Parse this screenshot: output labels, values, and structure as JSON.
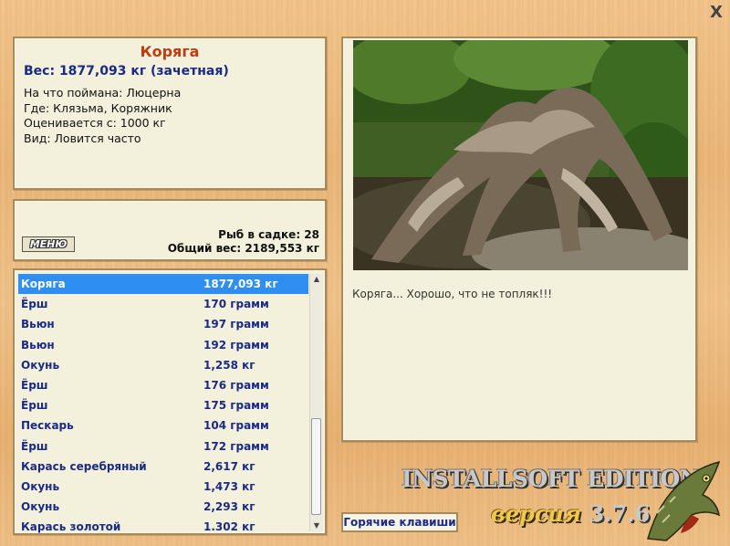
{
  "fish": {
    "name": "Коряга",
    "weight_line": "Вес: 1877,093 кг (зачетная)",
    "caught_on": "На что поймана: Люцерна",
    "where": "Где: Клязьма, Коряжник",
    "valued_from": "Оценивается с: 1000 кг",
    "kind": "Вид: Ловится часто"
  },
  "stats": {
    "menu_label": "МЕНЮ",
    "fish_in_net": "Рыб в садке: 28",
    "total_weight": "Общий вес: 2189,553 кг"
  },
  "catch_list": [
    {
      "name": "Коряга",
      "weight": "1877,093 кг",
      "selected": true
    },
    {
      "name": "Ёрш",
      "weight": "170 грамм"
    },
    {
      "name": "Вьюн",
      "weight": "197 грамм"
    },
    {
      "name": "Вьюн",
      "weight": "192 грамм"
    },
    {
      "name": "Окунь",
      "weight": "1,258 кг"
    },
    {
      "name": "Ёрш",
      "weight": "176 грамм"
    },
    {
      "name": "Ёрш",
      "weight": "175 грамм"
    },
    {
      "name": "Пескарь",
      "weight": "104 грамм"
    },
    {
      "name": "Ёрш",
      "weight": "172 грамм"
    },
    {
      "name": "Карась серебряный",
      "weight": "2,617 кг"
    },
    {
      "name": "Окунь",
      "weight": "1,473 кг"
    },
    {
      "name": "Окунь",
      "weight": "2,293 кг"
    },
    {
      "name": "Карась золотой",
      "weight": "1.302 кг"
    }
  ],
  "caption": "Коряга... Хорошо, что не топляк!!!",
  "hotkeys_label": "Горячие клавиши",
  "brand": {
    "edition": "INSTALLSOFT EDITION",
    "version_word": "версия",
    "version_number": "3.7.6"
  },
  "close_label": "X",
  "colors": {
    "title_red": "#c43a10",
    "text_blue": "#1a2a86",
    "selection": "#2f8ef2"
  },
  "icons": {
    "close": "close-icon",
    "pike": "pike-logo-icon",
    "scroll_up": "chevron-up-icon",
    "scroll_down": "chevron-down-icon"
  }
}
